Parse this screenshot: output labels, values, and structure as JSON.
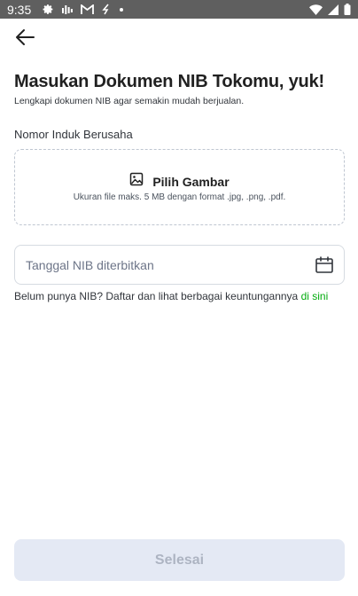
{
  "status_bar": {
    "time": "9:35",
    "icons": [
      "settings-icon",
      "signal-bars-icon",
      "gmail-icon",
      "sync-icon",
      "dot-icon",
      "wifi-icon",
      "cell-signal-icon",
      "battery-icon"
    ]
  },
  "header": {
    "back_icon": "arrow-left-icon"
  },
  "page": {
    "title": "Masukan Dokumen NIB Tokomu, yuk!",
    "subtitle": "Lengkapi dokumen NIB agar semakin mudah berjualan."
  },
  "upload": {
    "label": "Nomor Induk Berusaha",
    "button_label": "Pilih Gambar",
    "button_icon": "image-icon",
    "hint": "Ukuran file maks. 5 MB dengan format .jpg, .png, .pdf."
  },
  "date_field": {
    "placeholder": "Tanggal NIB diterbitkan",
    "value": "",
    "icon": "calendar-icon"
  },
  "info": {
    "text": "Belum punya NIB? Daftar dan lihat berbagai keuntungannya ",
    "link_text": "di sini"
  },
  "footer": {
    "done_label": "Selesai"
  },
  "colors": {
    "status_bar_bg": "#5f5f5f",
    "accent_green": "#03ac0e",
    "disabled_button_bg": "#e4e9f4",
    "disabled_button_text": "#adb4c2",
    "border": "#d6dbe1"
  }
}
